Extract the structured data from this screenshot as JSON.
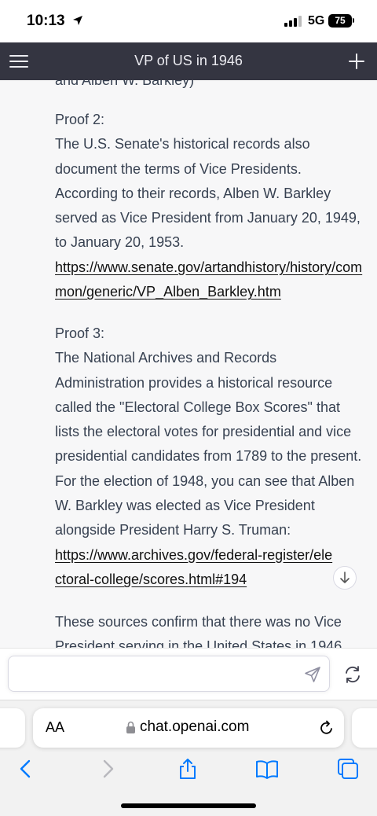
{
  "status_bar": {
    "time": "10:13",
    "network": "5G",
    "battery": "75"
  },
  "header": {
    "title": "VP of US in 1946"
  },
  "content": {
    "cut_off_top": "and Alben W. Barkley)",
    "proof2": {
      "heading": "Proof 2:",
      "text": "The U.S. Senate's historical records also document the terms of Vice Presidents. According to their records, Alben W. Barkley served as Vice President from January 20, 1949, to January 20, 1953.",
      "link": "https://www.senate.gov/artandhistory/history/common/generic/VP_Alben_Barkley.htm"
    },
    "proof3": {
      "heading": "Proof 3:",
      "text": "The National Archives and Records Administration provides a historical resource called the \"Electoral College Box Scores\" that lists the electoral votes for presidential and vice presidential candidates from 1789 to the present. For the election of 1948, you can see that Alben W. Barkley was elected as Vice President alongside President Harry S. Truman:",
      "link": "https://www.archives.gov/federal-register/electoral-college/scores.html#194"
    },
    "conclusion": "These sources confirm that there was no Vice President serving in the United States in 1946"
  },
  "composer": {
    "placeholder": ""
  },
  "safari": {
    "aa_label": "AA",
    "url": "chat.openai.com"
  },
  "colors": {
    "header_bg": "#343541",
    "content_bg": "#f7f7f8",
    "text": "#374151",
    "ios_blue": "#007aff"
  }
}
